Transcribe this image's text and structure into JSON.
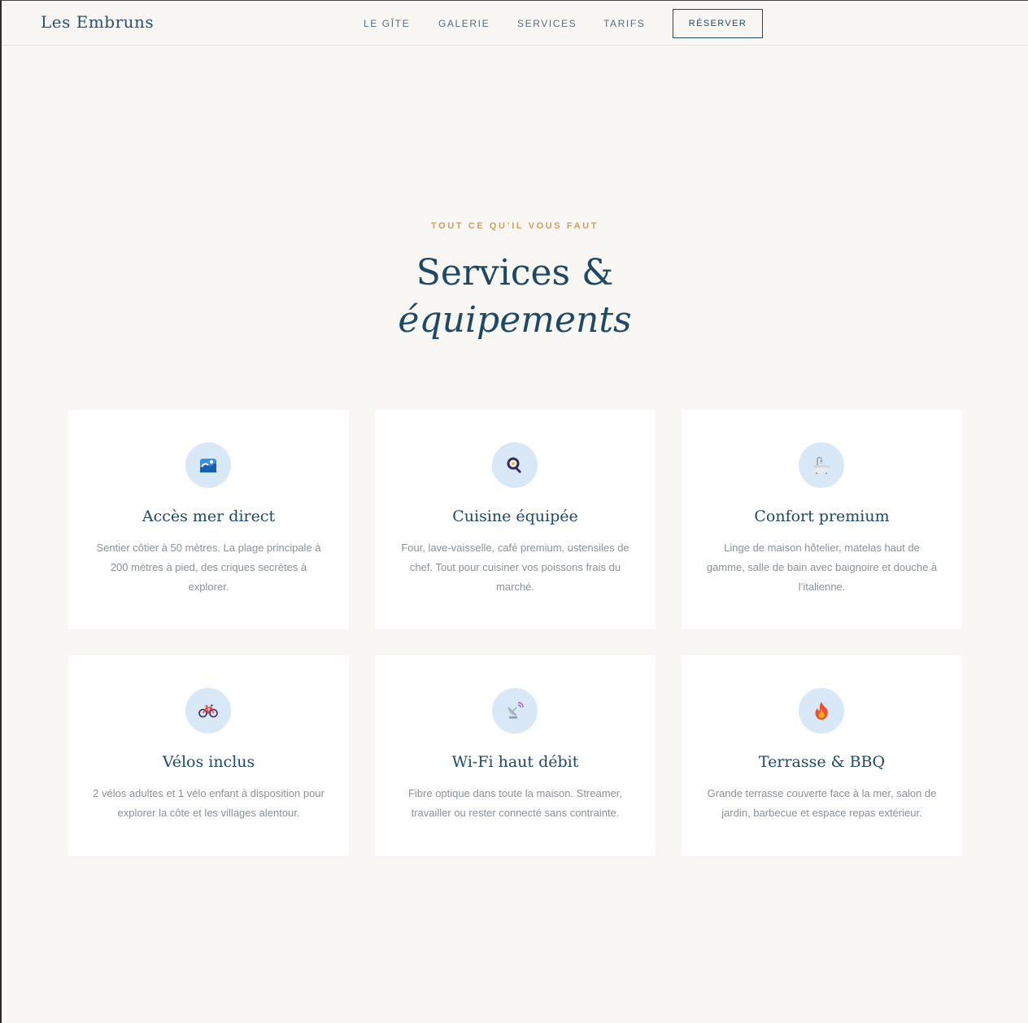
{
  "nav": {
    "brand": "Les Embruns",
    "links": [
      "LE GÎTE",
      "GALERIE",
      "SERVICES",
      "TARIFS"
    ],
    "cta": "RÉSERVER"
  },
  "section": {
    "eyebrow": "TOUT CE QU’IL VOUS FAUT",
    "title_line1": "Services &",
    "title_line2": "équipements"
  },
  "cards": [
    {
      "icon": "wave-icon",
      "title": "Accès mer direct",
      "desc": "Sentier côtier à 50 mètres. La plage principale à 200 mètres à pied, des criques secrètes à explorer."
    },
    {
      "icon": "frying-pan-icon",
      "title": "Cuisine équipée",
      "desc": "Four, lave-vaisselle, café premium, ustensiles de chef. Tout pour cuisiner vos poissons frais du marché."
    },
    {
      "icon": "bathtub-icon",
      "title": "Confort premium",
      "desc": "Linge de maison hôtelier, matelas haut de gamme, salle de bain avec baignoire et douche à l’italienne."
    },
    {
      "icon": "bicycle-icon",
      "title": "Vélos inclus",
      "desc": "2 vélos adultes et 1 vélo enfant à disposition pour explorer la côte et les villages alentour."
    },
    {
      "icon": "satellite-dish-icon",
      "title": "Wi-Fi haut débit",
      "desc": "Fibre optique dans toute la maison. Streamer, travailler ou rester connecté sans contrainte."
    },
    {
      "icon": "fire-icon",
      "title": "Terrasse & BBQ",
      "desc": "Grande terrasse couverte face à la mer, salon de jardin, barbecue et espace repas extérieur."
    }
  ],
  "colors": {
    "background": "#f8f7f4",
    "primary": "#1f4866",
    "accent": "#c9a066",
    "icon_bg": "#d9e8f6"
  }
}
